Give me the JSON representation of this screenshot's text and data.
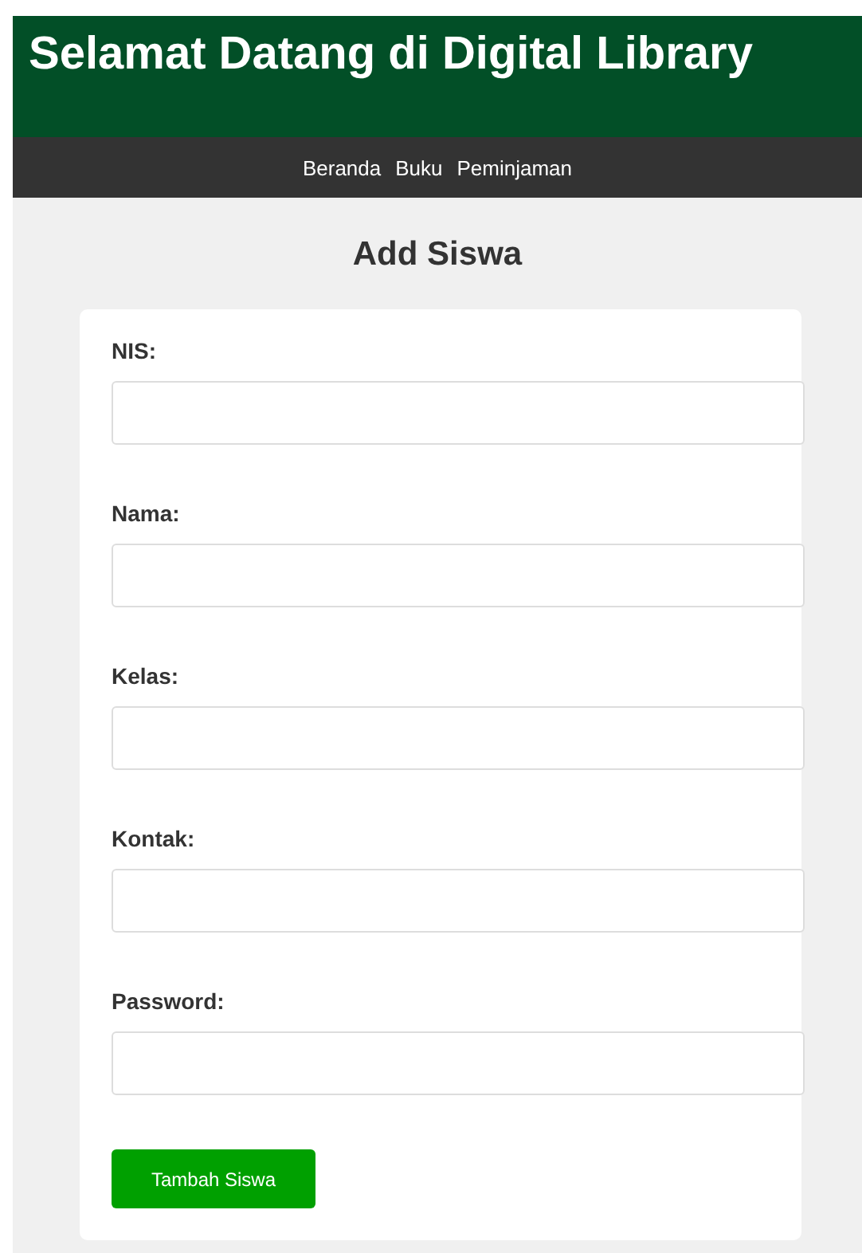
{
  "header": {
    "title": "Selamat Datang di Digital Library"
  },
  "nav": [
    {
      "label": "Beranda"
    },
    {
      "label": "Buku"
    },
    {
      "label": "Peminjaman"
    }
  ],
  "form": {
    "title": "Add Siswa",
    "fields": [
      {
        "label": "NIS:"
      },
      {
        "label": "Nama:"
      },
      {
        "label": "Kelas:"
      },
      {
        "label": "Kontak:"
      },
      {
        "label": "Password:"
      }
    ],
    "submit": "Tambah Siswa"
  }
}
